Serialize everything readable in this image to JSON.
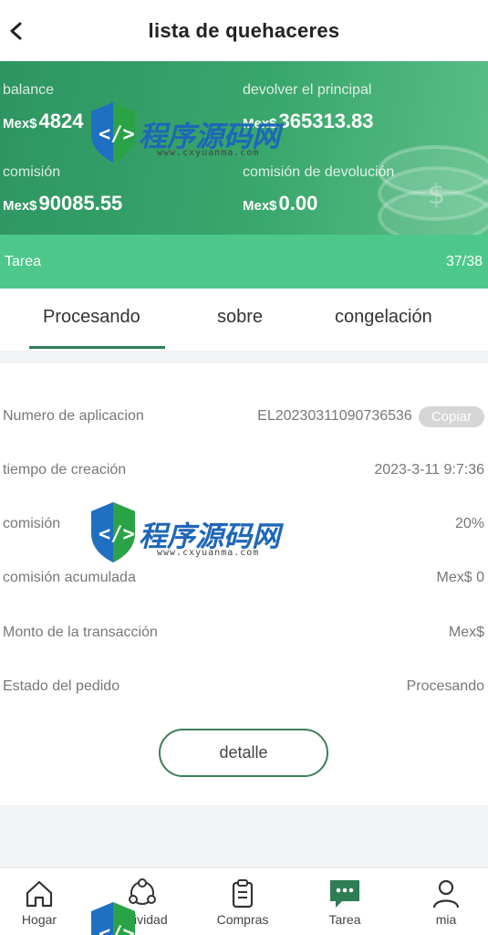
{
  "header": {
    "title": "lista de quehaceres"
  },
  "summary": {
    "balance_label": "balance",
    "balance_currency": "Mex$",
    "balance_value": "4824",
    "principal_label": "devolver el principal",
    "principal_currency": "Mex$",
    "principal_value": "365313.83",
    "commission_label": "comisión",
    "commission_currency": "Mex$",
    "commission_value": "90085.55",
    "refund_label": "comisión de devolución",
    "refund_currency": "Mex$",
    "refund_value": "0.00",
    "task_label": "Tarea",
    "task_count": "37/38"
  },
  "tabs": [
    {
      "label": "Procesando",
      "active": true
    },
    {
      "label": "sobre",
      "active": false
    },
    {
      "label": "congelación",
      "active": false
    }
  ],
  "details": {
    "rows": [
      {
        "label": "Numero de aplicacion",
        "value": "EL20230311090736536"
      },
      {
        "label": "tiempo de creación",
        "value": "2023-3-11 9:7:36"
      },
      {
        "label": "comisión",
        "value": "20%"
      },
      {
        "label": "comisión acumulada",
        "value": "Mex$ 0"
      },
      {
        "label": "Monto de la transacción",
        "value": "Mex$"
      },
      {
        "label": "Estado del pedido",
        "value": "Procesando"
      }
    ],
    "copy_label": "Copiar",
    "detail_button": "detalle"
  },
  "bottom_nav": [
    {
      "label": "Hogar",
      "icon": "home-icon"
    },
    {
      "label": "actividad",
      "icon": "activity-icon"
    },
    {
      "label": "Compras",
      "icon": "clipboard-icon"
    },
    {
      "label": "Tarea",
      "icon": "chat-icon",
      "active": true
    },
    {
      "label": "mia",
      "icon": "user-icon"
    }
  ],
  "watermark": {
    "text": "程序源码网",
    "url": "www.cxyuanma.com"
  },
  "colors": {
    "accent": "#3aa76c",
    "task_bar": "#4dc88a",
    "tab_underline": "#2f7d55",
    "button_border": "#3b7f58"
  }
}
